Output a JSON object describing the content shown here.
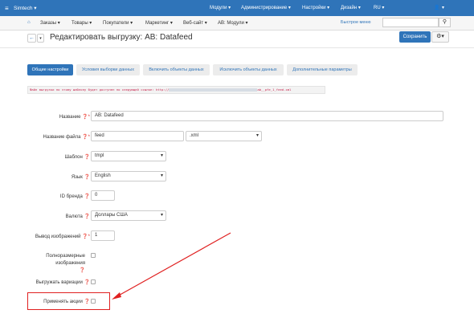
{
  "topbar": {
    "store": "Simtech ▾",
    "items": [
      "Модули ▾",
      "Администрирование ▾",
      "Настройки ▾",
      "Дизайн ▾",
      "RU ▾",
      "▾"
    ]
  },
  "navbar": {
    "items": [
      "Заказы ▾",
      "Товары ▾",
      "Покупатели ▾",
      "Маркетинг ▾",
      "Веб-сайт ▾",
      "AB: Модули ▾"
    ],
    "quick_menu": "Быстрое меню"
  },
  "header": {
    "title": "Редактировать выгрузку: AB: Datafeed",
    "save_label": "Сохранить"
  },
  "tabs": [
    "Общие настройки",
    "Условия выборки данных",
    "Включить объекты данных",
    "Исключить объекты данных",
    "Дополнительные параметры"
  ],
  "notice": {
    "text_before": "Файл выгрузки по этому шаблону будет доступен по следующей ссылке: http://",
    "text_after": "ab__pfe_1_feed.xml"
  },
  "form": {
    "name_label": "Название",
    "name_value": "AB: Datafeed",
    "filename_label": "Название файла",
    "filename_value": "feed",
    "ext_value": ".xml",
    "template_label": "Шаблон",
    "template_value": "tmpl",
    "lang_label": "Язык",
    "lang_value": "English",
    "brand_label": "ID бренда",
    "brand_value": "0",
    "currency_label": "Валюта",
    "currency_value": "Доллары США",
    "images_label": "Вывод изображений",
    "images_value": "1",
    "fullsize_label_1": "Полноразмерные",
    "fullsize_label_2": "изображения",
    "variations_label": "Выгружать вариации",
    "promo_label": "Применять акции"
  },
  "colors": {
    "accent": "#2f74b9",
    "highlight": "#e02020"
  }
}
